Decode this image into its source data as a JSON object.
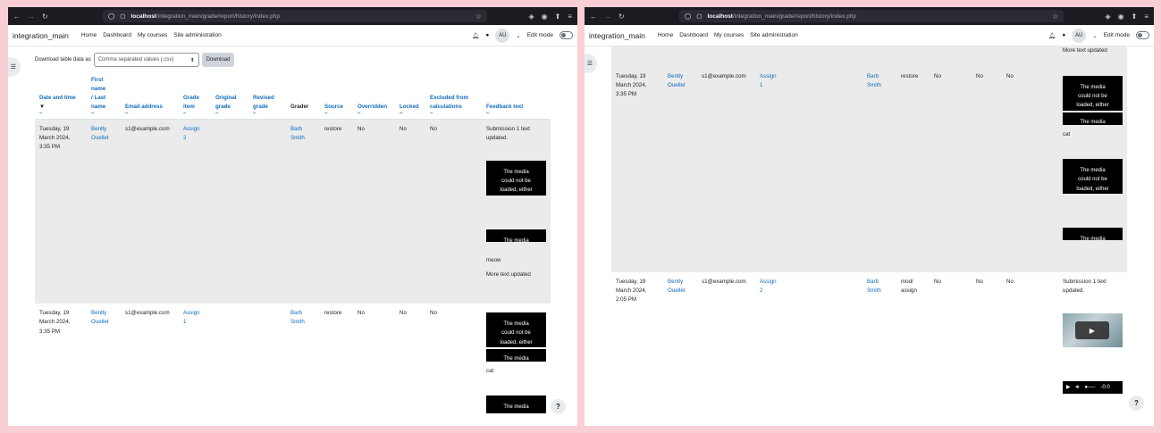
{
  "browser": {
    "host": "localhost",
    "path": "/integration_main/grade/report/history/index.php"
  },
  "navbar": {
    "site_name": "integration_main",
    "links": [
      "Home",
      "Dashboard",
      "My courses",
      "Site administration"
    ],
    "avatar_initials": "AU",
    "edit_mode_label": "Edit mode"
  },
  "download": {
    "label": "Download table data as",
    "format_selected": "Comma separated values (.csv)",
    "button_label": "Download"
  },
  "table": {
    "headers": {
      "date_time": "Date and time",
      "name_first": "First",
      "name_name": "name",
      "name_last": "/ Last",
      "name_name2": "name",
      "email": "Email address",
      "grade_item_1": "Grade",
      "grade_item_2": "item",
      "original_1": "Original",
      "original_2": "grade",
      "revised_1": "Revised",
      "revised_2": "grade",
      "grader": "Grader",
      "source": "Source",
      "overridden": "Overridden",
      "locked": "Locked",
      "excluded_1": "Excluded from",
      "excluded_2": "calculations",
      "feedback": "Feedback text"
    },
    "dash": "–",
    "sort_icon": "▼"
  },
  "rows": [
    {
      "date_1": "Tuesday, 19",
      "date_2": "March 2024,",
      "date_3": "3:35 PM",
      "first": "Bently",
      "last": "Ouellet",
      "email": "s1@example.com",
      "item_1": "Assign",
      "item_2": "2",
      "grader_1": "Barb",
      "grader_2": "Smith",
      "source": "restore",
      "overridden": "No",
      "locked": "No",
      "excluded": "No",
      "feedback_1": "Submission 1 text",
      "feedback_2": "updated.",
      "feedback_meow": "meow",
      "feedback_more": "More text updated"
    },
    {
      "date_1": "Tuesday, 19",
      "date_2": "March 2024,",
      "date_3": "3:35 PM",
      "first": "Bently",
      "last": "Ouellet",
      "email": "s1@example.com",
      "item_1": "Assign",
      "item_2": "1",
      "grader_1": "Barb",
      "grader_2": "Smith",
      "source": "restore",
      "overridden": "No",
      "locked": "No",
      "excluded": "No",
      "feedback_cat": "cat"
    },
    {
      "date_1": "Tuesday, 19",
      "date_2": "March 2024,",
      "date_3": "2:05 PM",
      "first": "Bently",
      "last": "Ouellet",
      "email": "s1@example.com",
      "item_1": "Assign",
      "item_2": "2",
      "grader_1": "Barb",
      "grader_2": "Smith",
      "source_1": "mod/",
      "source_2": "assign",
      "overridden": "No",
      "locked": "No",
      "excluded": "No",
      "feedback_1": "Submission 1 text",
      "feedback_2": "updated."
    }
  ],
  "media_error": {
    "line1": "The media",
    "line2": "could not be",
    "line3": "loaded, either"
  },
  "audio_time": "-0:0",
  "right_top_feedback": "More text updated",
  "help_label": "?"
}
